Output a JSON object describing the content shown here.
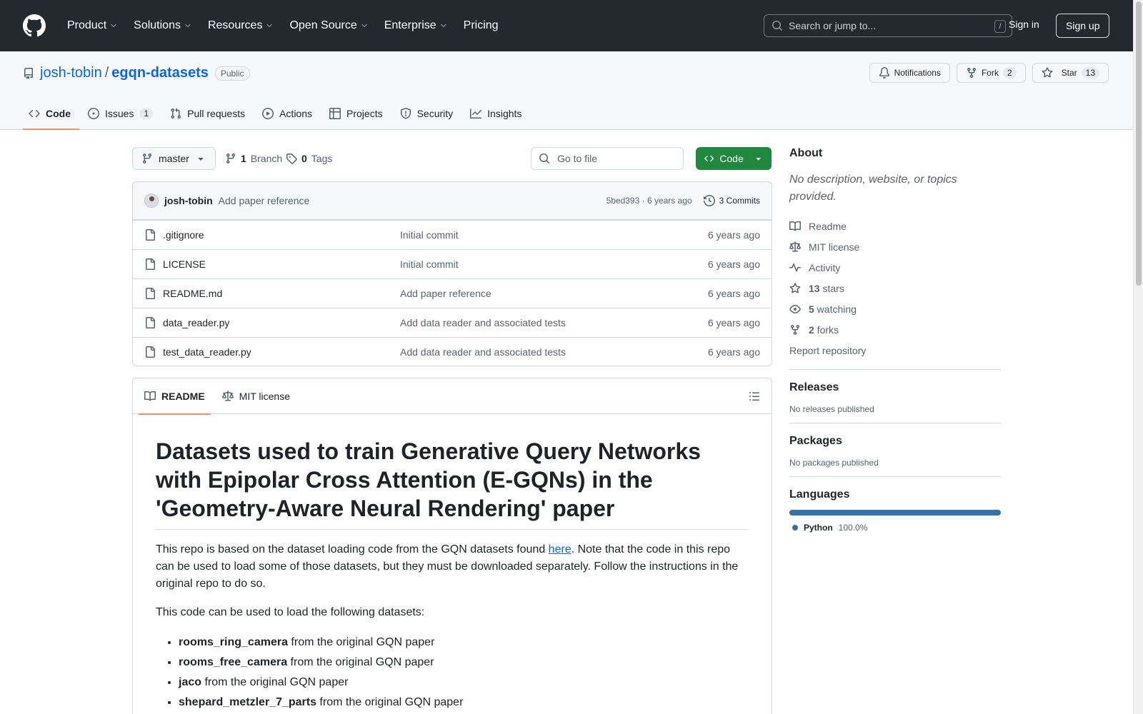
{
  "header": {
    "nav": [
      "Product",
      "Solutions",
      "Resources",
      "Open Source",
      "Enterprise",
      "Pricing"
    ],
    "search_placeholder": "Search or jump to...",
    "search_shortcut": "/",
    "sign_in": "Sign in",
    "sign_up": "Sign up"
  },
  "repo": {
    "owner": "josh-tobin",
    "separator": "/",
    "name": "egqn-datasets",
    "visibility": "Public",
    "notifications_label": "Notifications",
    "fork_label": "Fork",
    "fork_count": "2",
    "star_label": "Star",
    "star_count": "13",
    "tabs": [
      {
        "label": "Code",
        "icon": "code-icon"
      },
      {
        "label": "Issues",
        "count": "1",
        "icon": "issue-icon"
      },
      {
        "label": "Pull requests",
        "icon": "pull-request-icon"
      },
      {
        "label": "Actions",
        "icon": "play-icon"
      },
      {
        "label": "Projects",
        "icon": "table-icon"
      },
      {
        "label": "Security",
        "icon": "shield-icon"
      },
      {
        "label": "Insights",
        "icon": "graph-icon"
      }
    ]
  },
  "toolbar": {
    "branch": "master",
    "branch_count": "1",
    "branch_label": "Branch",
    "tag_count": "0",
    "tag_label": "Tags",
    "goto_placeholder": "Go to file",
    "code_button": "Code"
  },
  "latest_commit": {
    "author": "josh-tobin",
    "message": "Add paper reference",
    "sha_and_age": "5bed393 · 6 years ago",
    "commits": "3 Commits"
  },
  "files": [
    {
      "name": ".gitignore",
      "message": "Initial commit",
      "age": "6 years ago"
    },
    {
      "name": "LICENSE",
      "message": "Initial commit",
      "age": "6 years ago"
    },
    {
      "name": "README.md",
      "message": "Add paper reference",
      "age": "6 years ago"
    },
    {
      "name": "data_reader.py",
      "message": "Add data reader and associated tests",
      "age": "6 years ago"
    },
    {
      "name": "test_data_reader.py",
      "message": "Add data reader and associated tests",
      "age": "6 years ago"
    }
  ],
  "readme": {
    "tab_readme": "README",
    "tab_license": "MIT license",
    "title": "Datasets used to train Generative Query Networks with Epipolar Cross Attention (E-GQNs) in the 'Geometry-Aware Neural Rendering' paper",
    "p1_before": "This repo is based on the dataset loading code from the GQN datasets found ",
    "p1_link": "here",
    "p1_after": ". Note that the code in this repo can be used to load some of those datasets, but they must be downloaded separately. Follow the instructions in the original repo to do so.",
    "p2": "This code can be used to load the following datasets:",
    "list": [
      {
        "name": "rooms_ring_camera",
        "rest": " from the original GQN paper"
      },
      {
        "name": "rooms_free_camera",
        "rest": " from the original GQN paper"
      },
      {
        "name": "jaco",
        "rest": " from the original GQN paper"
      },
      {
        "name": "shepard_metzler_7_parts",
        "rest": " from the original GQN paper"
      }
    ]
  },
  "sidebar": {
    "about_title": "About",
    "about_desc": "No description, website, or topics provided.",
    "readme": "Readme",
    "license": "MIT license",
    "activity": "Activity",
    "stars_count": "13",
    "stars_label": " stars",
    "watching_count": "5",
    "watching_label": " watching",
    "forks_count": "2",
    "forks_label": " forks",
    "report": "Report repository",
    "releases_title": "Releases",
    "releases_empty": "No releases published",
    "packages_title": "Packages",
    "packages_empty": "No packages published",
    "languages_title": "Languages",
    "language_name": "Python",
    "language_pct": "100.0%",
    "language_color": "#3572a5"
  }
}
